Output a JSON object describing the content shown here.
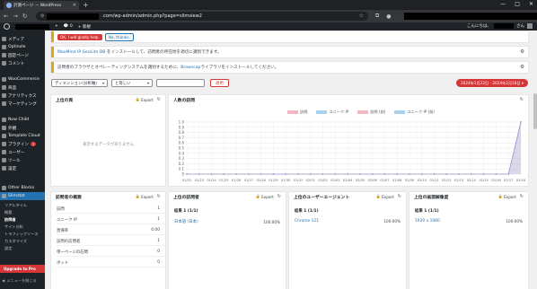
{
  "browser": {
    "tab_title": "計測ページ — WordPress",
    "url": ".com/wp-admin/admin.php?page=slimview2",
    "new_tab": "+",
    "window_controls": [
      "—",
      "□",
      "✕"
    ]
  },
  "adminbar": {
    "items": [
      "+",
      "💬 0",
      "+ 新規"
    ],
    "greeting": "こんにちは、",
    "greeting_suffix": "さん"
  },
  "sidebar": {
    "items": [
      {
        "label": "メディア"
      },
      {
        "label": "Optinole"
      },
      {
        "label": "固定ページ"
      },
      {
        "label": "コメント"
      },
      {
        "label": "WooCommerce"
      },
      {
        "label": "商品"
      },
      {
        "label": "アナリティクス"
      },
      {
        "label": "マーケティング"
      },
      {
        "label": "Now Child"
      },
      {
        "label": "外観"
      },
      {
        "label": "Template Cloud"
      },
      {
        "label": "プラグイン",
        "badge": "2"
      },
      {
        "label": "ユーザー"
      },
      {
        "label": "ツール"
      },
      {
        "label": "設定"
      },
      {
        "label": "Other Blocks"
      },
      {
        "label": "Slimstat"
      }
    ],
    "submenu": [
      "リアルタイム",
      "概要",
      "訪問者",
      "サイト分析",
      "トラフィックソース",
      "カスタマイズ",
      "設定"
    ],
    "upgrade": "Upgrade to Pro",
    "collapse": "メニューを閉じる"
  },
  "notices": {
    "feedback_btn_yes": "OK, I will gladly help.",
    "feedback_btn_no": "No, thanks.",
    "maxmind_link": "MaxMind IP GeoLite DB",
    "maxmind_text": " をインストールして、訪問者の所在地を適切に識別できます。",
    "browscap_text": "訪問者のブラウザとオペレーティングシステムを識別するために、",
    "browscap_link": "Browscap",
    "browscap_text2": "ライブラリをインストールしてください。"
  },
  "filters": {
    "dimension": "ディメンション(分析軸)",
    "operator": "と等しい",
    "apply": "適用",
    "date_range": "2024年1月22日 - 2024年2月18日"
  },
  "panels": {
    "top_pages": {
      "title": "上位の頁",
      "export": "Export",
      "empty": "表示するデータがありません"
    },
    "visitors_chart": {
      "title": "人数の訪問"
    },
    "overview": {
      "title": "訪問者の概要",
      "export": "Export",
      "rows": [
        {
          "label": "訪問",
          "value": "1"
        },
        {
          "label": "ユニーク IP",
          "value": "1"
        },
        {
          "label": "直帰率",
          "value": "0.00"
        },
        {
          "label": "訪問の訪問者",
          "value": "1"
        },
        {
          "label": "単一ページの訪問",
          "value": "0"
        },
        {
          "label": "ボット",
          "value": "0"
        }
      ]
    },
    "top_os": {
      "title": "上位の訪問者",
      "export": "Export",
      "col": "結果 1 (1/1)",
      "row_label": "日本語 (日本)",
      "row_value": "100.00%"
    },
    "top_ua": {
      "title": "上位のユーザーエージェント",
      "export": "Export",
      "col": "結果 1 (1/1)",
      "row_label": "Chrome 121",
      "row_value": "100.00%"
    },
    "top_res": {
      "title": "上位の画面解像度",
      "export": "Export",
      "col": "結果 1 (1/1)",
      "row_label": "1920 x 1080",
      "row_value": "100.00%"
    }
  },
  "chart_data": {
    "type": "area",
    "title": "",
    "legend": [
      "訪問",
      "ユニーク IP",
      "訪問 (前)",
      "ユニーク IP (前)"
    ],
    "legend_colors": [
      "#f4b6c2",
      "#a8d3f0",
      "#f4b6c2",
      "#a8d3f0"
    ],
    "x": [
      "01/22",
      "01/23",
      "01/24",
      "01/25",
      "01/26",
      "01/27",
      "01/28",
      "01/29",
      "01/30",
      "01/31",
      "02/01",
      "02/02",
      "02/03",
      "02/04",
      "02/05",
      "02/06",
      "02/07",
      "02/08",
      "02/09",
      "02/10",
      "02/11",
      "02/12",
      "02/13",
      "02/14",
      "02/15",
      "02/16",
      "02/17",
      "02/18"
    ],
    "series": [
      {
        "name": "訪問",
        "color": "#9b8fc9",
        "values": [
          0,
          0,
          0,
          0,
          0,
          0,
          0,
          0,
          0,
          0,
          0,
          0,
          0,
          0,
          0,
          0,
          0,
          0,
          0,
          0,
          0,
          0,
          0,
          0,
          0,
          0,
          0,
          1
        ]
      }
    ],
    "y_ticks": [
      "0",
      "0.1",
      "0.2",
      "0.3",
      "0.4",
      "0.5",
      "0.6",
      "0.7",
      "0.8",
      "0.9",
      "1.0"
    ],
    "ylim": [
      0,
      1
    ]
  }
}
